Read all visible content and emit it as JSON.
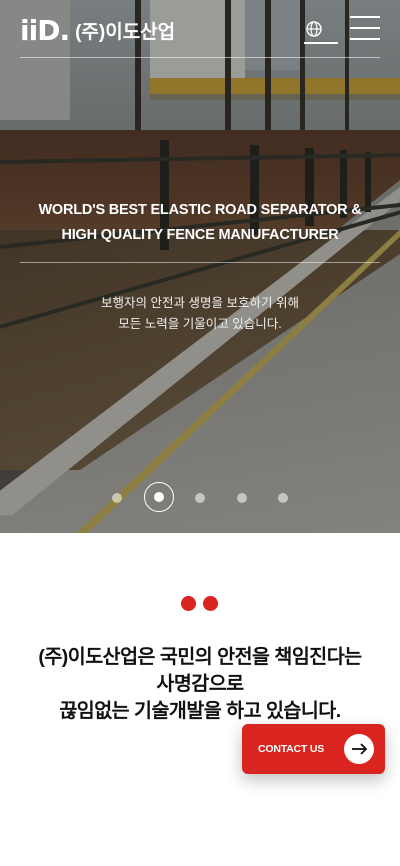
{
  "header": {
    "logo_mark": "iiD.",
    "company_name": "(주)이도산업",
    "icons": [
      "globe-icon",
      "menu-icon"
    ]
  },
  "hero": {
    "title_line1": "WORLD'S BEST ELASTIC ROAD SEPARATOR &",
    "title_line2": "HIGH QUALITY FENCE MANUFACTURER",
    "subtitle_line1": "보행자의 안전과 생명을 보호하기 위해",
    "subtitle_line2": "모든 노력을 기울이고 있습니다.",
    "slide_count": 5,
    "active_slide": 2
  },
  "statement": {
    "line1": "(주)이도산업은 국민의 안전을 책임진다는",
    "line2": "사명감으로",
    "line3": "끊임없는 기술개발을 하고 있습니다."
  },
  "contact": {
    "label": "CONTACT US",
    "icon": "arrow-right-icon"
  },
  "colors": {
    "accent": "#d9241f",
    "text_dark": "#111111",
    "white": "#ffffff"
  }
}
